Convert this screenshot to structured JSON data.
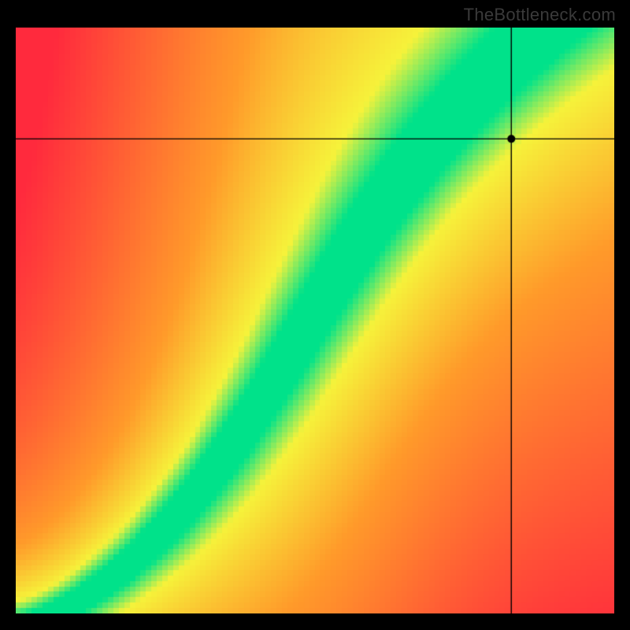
{
  "watermark": "TheBottleneck.com",
  "chart_data": {
    "type": "heatmap",
    "title": "",
    "xlabel": "",
    "ylabel": "",
    "x_range": [
      0,
      100
    ],
    "y_range": [
      0,
      100
    ],
    "optimal_curve_description": "monotonic curve from (0,0) sweeping up and right; slightly concave for low x then steepening, band of green around it, yellow halo, red far from it",
    "band_halfwidth_normalized": 0.05,
    "marker": {
      "x_frac": 0.828,
      "y_frac": 0.81
    },
    "crosshair": {
      "x_frac": 0.828,
      "y_frac": 0.81
    },
    "colors": {
      "optimal": "#00e28a",
      "near": "#f6f23a",
      "mid": "#ff9a2a",
      "far": "#ff2a3d"
    }
  }
}
